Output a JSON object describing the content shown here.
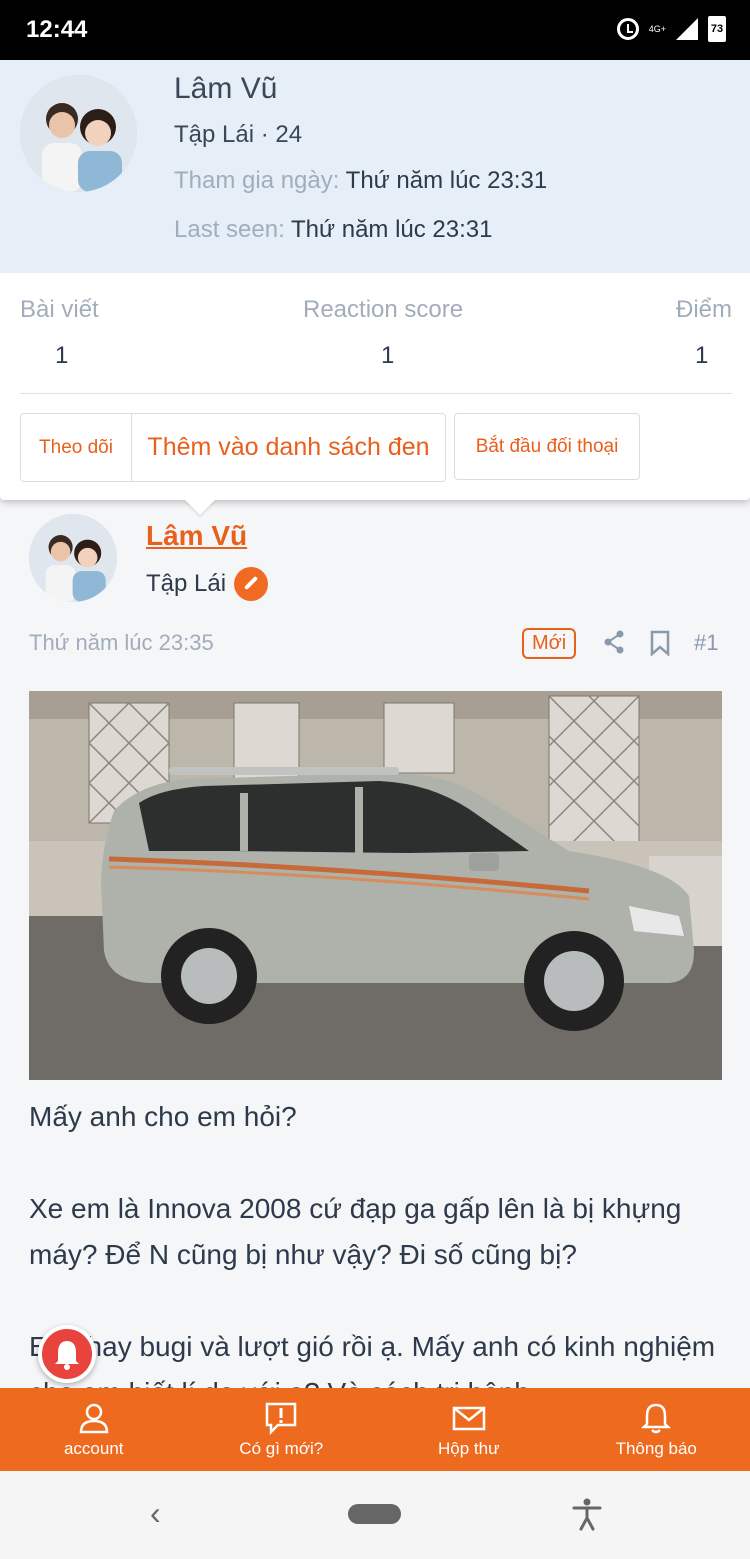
{
  "status_bar": {
    "time": "12:44",
    "network": "4G+",
    "battery": "73",
    "icons": [
      "alarm-icon",
      "signal-icon",
      "battery-icon"
    ]
  },
  "profile": {
    "name": "Lâm Vũ",
    "role_age": "Tập Lái · 24",
    "joined_label": "Tham gia ngày:",
    "joined_value": "Thứ năm lúc 23:31",
    "last_seen_label": "Last seen:",
    "last_seen_value": "Thứ năm lúc 23:31",
    "stats": [
      {
        "label": "Bài viết",
        "value": "1"
      },
      {
        "label": "Reaction score",
        "value": "1"
      },
      {
        "label": "Điểm",
        "value": "1"
      }
    ],
    "buttons": {
      "follow": "Theo dõi",
      "ignore": "Thêm vào danh sách đen",
      "conversation": "Bắt đầu đối thoại"
    }
  },
  "post": {
    "author": "Lâm Vũ",
    "role": "Tập Lái",
    "time": "Thứ năm lúc 23:35",
    "new_badge": "Mới",
    "number": "#1",
    "body": [
      "Mấy anh cho em hỏi?",
      "Xe em là Innova 2008 cứ đạp ga gấp lên là bị khựng máy? Để N cũng bị như vậy? Đi số cũng bị?",
      "Em thay bugi và lượt gió rồi ạ. Mấy anh có kinh nghiệm cho em biết lí do với ạ? Và cách trị bệnh"
    ]
  },
  "bottom_nav": [
    {
      "label": "account",
      "icon": "account-icon"
    },
    {
      "label": "Có gì mới?",
      "icon": "whats-new-icon"
    },
    {
      "label": "Hộp thư",
      "icon": "inbox-icon"
    },
    {
      "label": "Thông báo",
      "icon": "bell-icon"
    }
  ],
  "colors": {
    "accent": "#e8601c",
    "nav_bg": "#ee6a1f",
    "profile_bg": "#e6eef8"
  }
}
